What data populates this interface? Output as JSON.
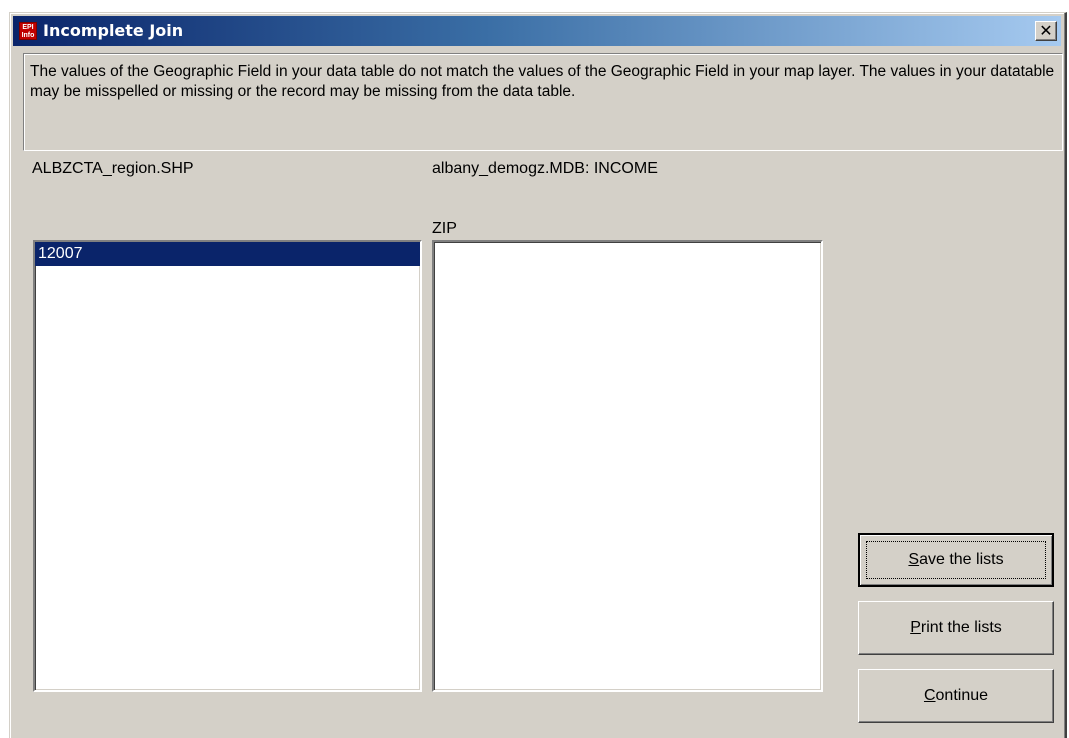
{
  "window": {
    "title": "Incomplete Join",
    "icon_text": "EPI Info",
    "close_glyph": "✕"
  },
  "message": "The values of the Geographic Field in your data table do not match the values of the Geographic Field in your map layer. The values in your datatable may be misspelled or missing or the record may be missing from the data table.",
  "left_panel": {
    "label": "ALBZCTA_region.SHP",
    "items": [
      "12007"
    ],
    "selected_index": 0
  },
  "right_panel": {
    "label": "albany_demogz.MDB: INCOME",
    "field_label": "ZIP",
    "items": []
  },
  "buttons": {
    "save": {
      "mnemonic": "S",
      "rest": "ave the lists"
    },
    "print": {
      "mnemonic": "P",
      "rest": "rint the lists"
    },
    "continue": {
      "mnemonic": "C",
      "rest": "ontinue"
    }
  },
  "colors": {
    "titlebar_start": "#0a246a",
    "titlebar_end": "#a6caf0",
    "dialog_face": "#d4d0c8",
    "selection": "#0a246a"
  }
}
